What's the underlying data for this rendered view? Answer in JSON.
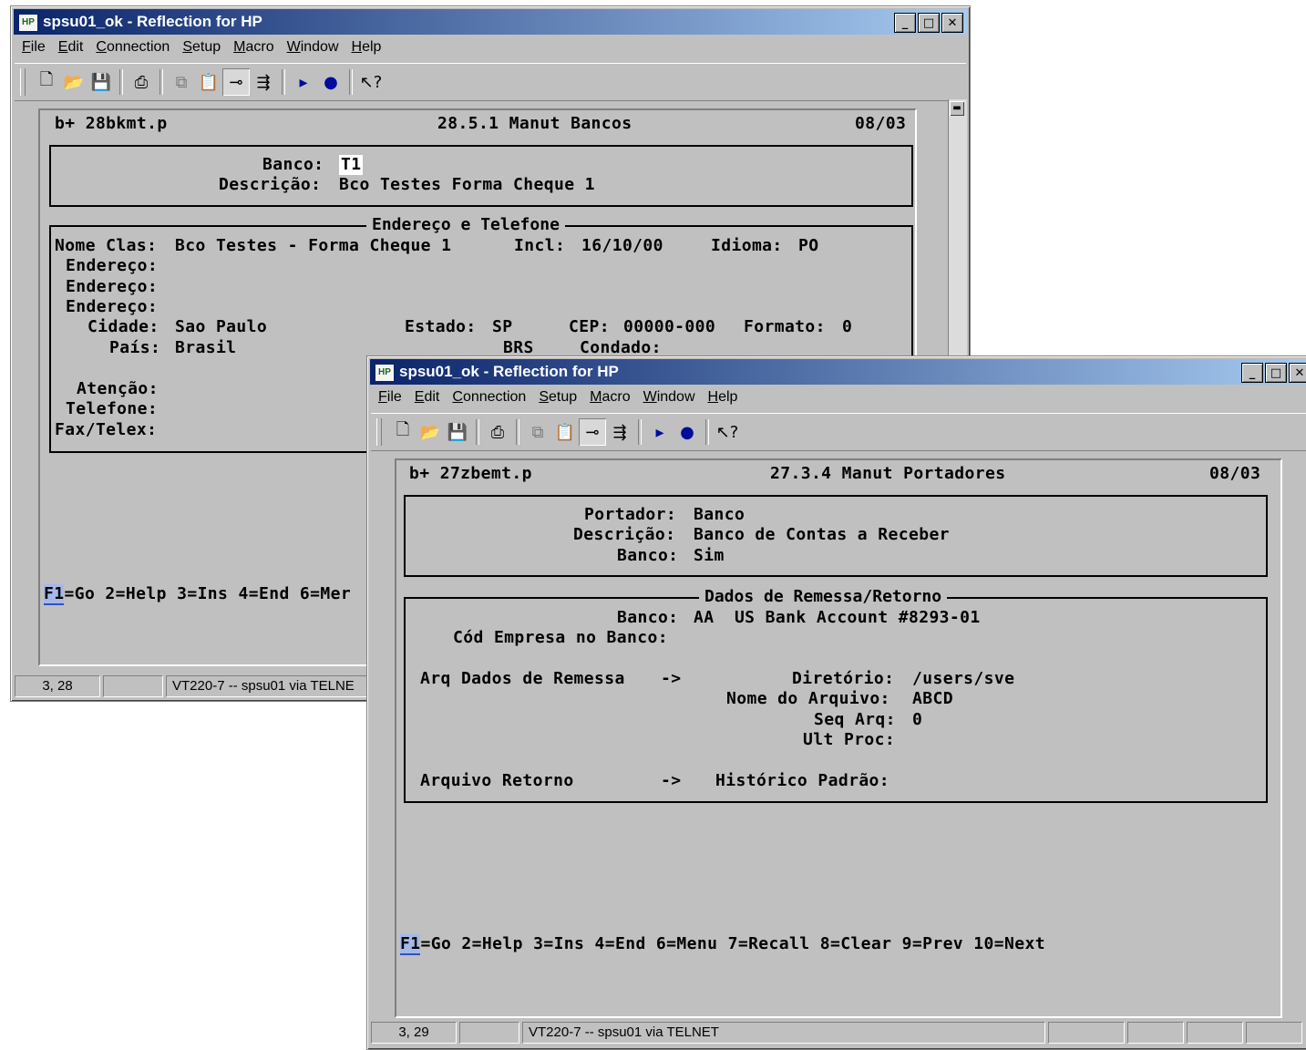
{
  "windows": {
    "win1": {
      "title": "spsu01_ok - Reflection for HP",
      "icon_label": "HP",
      "menu": [
        "File",
        "Edit",
        "Connection",
        "Setup",
        "Macro",
        "Window",
        "Help"
      ],
      "terminal": {
        "program": "b+ 28bkmt.p",
        "screen_title": "28.5.1 Manut Bancos",
        "date": "08/03",
        "banco_label": "Banco:",
        "banco_value": "T1",
        "descricao_label": "Descrição:",
        "descricao_value": "Bco Testes Forma Cheque 1",
        "section_title": "Endereço e Telefone",
        "nome_clas_label": "Nome Clas:",
        "nome_clas_value": "Bco Testes - Forma Cheque 1",
        "incl_label": "Incl:",
        "incl_value": "16/10/00",
        "idioma_label": "Idioma:",
        "idioma_value": "PO",
        "endereco_label": "Endereço:",
        "cidade_label": "Cidade:",
        "cidade_value": "Sao Paulo",
        "estado_label": "Estado:",
        "estado_value": "SP",
        "cep_label": "CEP:",
        "cep_value": "00000-000",
        "formato_label": "Formato:",
        "formato_value": "0",
        "pais_label": "País:",
        "pais_value": "Brasil",
        "pais_code": "BRS",
        "condado_label": "Condado:",
        "atencao_label": "Atenção:",
        "telefone_label": "Telefone:",
        "fax_label": "Fax/Telex:",
        "fkeys_f1": "F1",
        "fkeys_rest": "=Go 2=Help 3=Ins 4=End 6=Mer"
      },
      "status": {
        "cursor": "3, 28",
        "connection": "VT220-7 -- spsu01 via TELNE"
      }
    },
    "win2": {
      "title": "spsu01_ok - Reflection for HP",
      "icon_label": "HP",
      "menu": [
        "File",
        "Edit",
        "Connection",
        "Setup",
        "Macro",
        "Window",
        "Help"
      ],
      "terminal": {
        "program": "b+ 27zbemt.p",
        "screen_title": "27.3.4 Manut Portadores",
        "date": "08/03",
        "portador_label": "Portador:",
        "portador_value": "Banco",
        "descricao_label": "Descrição:",
        "descricao_value": "Banco de Contas a Receber",
        "banco_label": "Banco:",
        "banco_value": "Sim",
        "section_title": "Dados de Remessa/Retorno",
        "banco2_label": "Banco:",
        "banco2_value": "AA  US Bank Account #8293-01",
        "cod_empresa_label": "Cód Empresa no Banco:",
        "arq_remessa_label": "Arq Dados de Remessa",
        "arrow": "->",
        "diretorio_label": "Diretório:",
        "diretorio_value": "/users/sve",
        "nome_arquivo_label": "Nome do Arquivo:",
        "nome_arquivo_value": "ABCD",
        "seq_arq_label": "Seq Arq:",
        "seq_arq_value": "0",
        "ult_proc_label": "Ult Proc:",
        "arquivo_retorno_label": "Arquivo Retorno",
        "historico_label": "Histórico Padrão:",
        "fkeys_f1": "F1",
        "fkeys_rest": "=Go 2=Help 3=Ins 4=End 6=Menu 7=Recall 8=Clear 9=Prev 10=Next"
      },
      "status": {
        "cursor": "3, 29",
        "connection": "VT220-7 -- spsu01 via TELNET"
      }
    }
  },
  "toolbar_icons": [
    "new-file-icon",
    "open-folder-icon",
    "save-icon",
    "print-icon",
    "copy-icon",
    "paste-icon",
    "connect-icon",
    "transfer-icon",
    "play-macro-icon",
    "record-macro-icon",
    "context-help-icon"
  ],
  "colors": {
    "titlebar_active": "#0a246a",
    "window_bg": "#c0c0c0"
  }
}
